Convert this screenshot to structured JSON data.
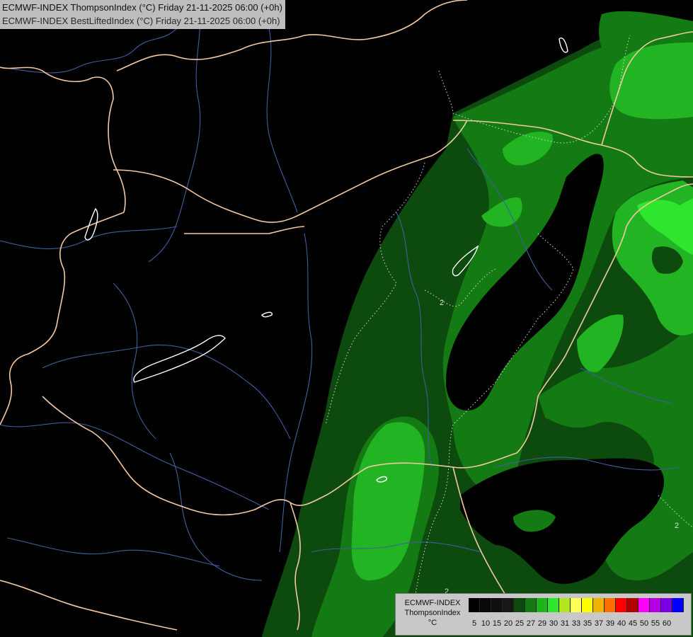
{
  "header": {
    "line1": "ECMWF-INDEX ThompsonIndex (°C) Friday 21-11-2025 06:00 (+0h)",
    "line2": "ECMWF-INDEX BestLiftedIndex (°C) Friday 21-11-2025 06:00 (+0h)"
  },
  "map": {
    "colors": {
      "background": "#000000",
      "green_dark": "#0d4a0d",
      "green_mid": "#147a14",
      "green_bright": "#23b423",
      "green_lime": "#2ee62e",
      "borders": "#f2c9a0",
      "rivers": "#3f5f9f",
      "lakes_outline": "#ffffff"
    },
    "contour_labels": [
      "2",
      "2",
      "2"
    ]
  },
  "legend": {
    "title_lines": [
      "ECMWF-INDEX",
      "ThompsonIndex",
      "°C"
    ],
    "swatches": [
      "#000000",
      "#080808",
      "#101010",
      "#181818",
      "#0d4a0d",
      "#147a14",
      "#1eb41e",
      "#2ee62e",
      "#b4e61e",
      "#ffff5a",
      "#ffff00",
      "#f0b400",
      "#ff6e00",
      "#ff0000",
      "#b40000",
      "#ff00ff",
      "#b400e6",
      "#7a00e6",
      "#0000ff"
    ],
    "labels": [
      "5",
      "10",
      "15",
      "20",
      "25",
      "27",
      "29",
      "30",
      "31",
      "33",
      "35",
      "37",
      "39",
      "40",
      "45",
      "50",
      "55",
      "60"
    ]
  }
}
